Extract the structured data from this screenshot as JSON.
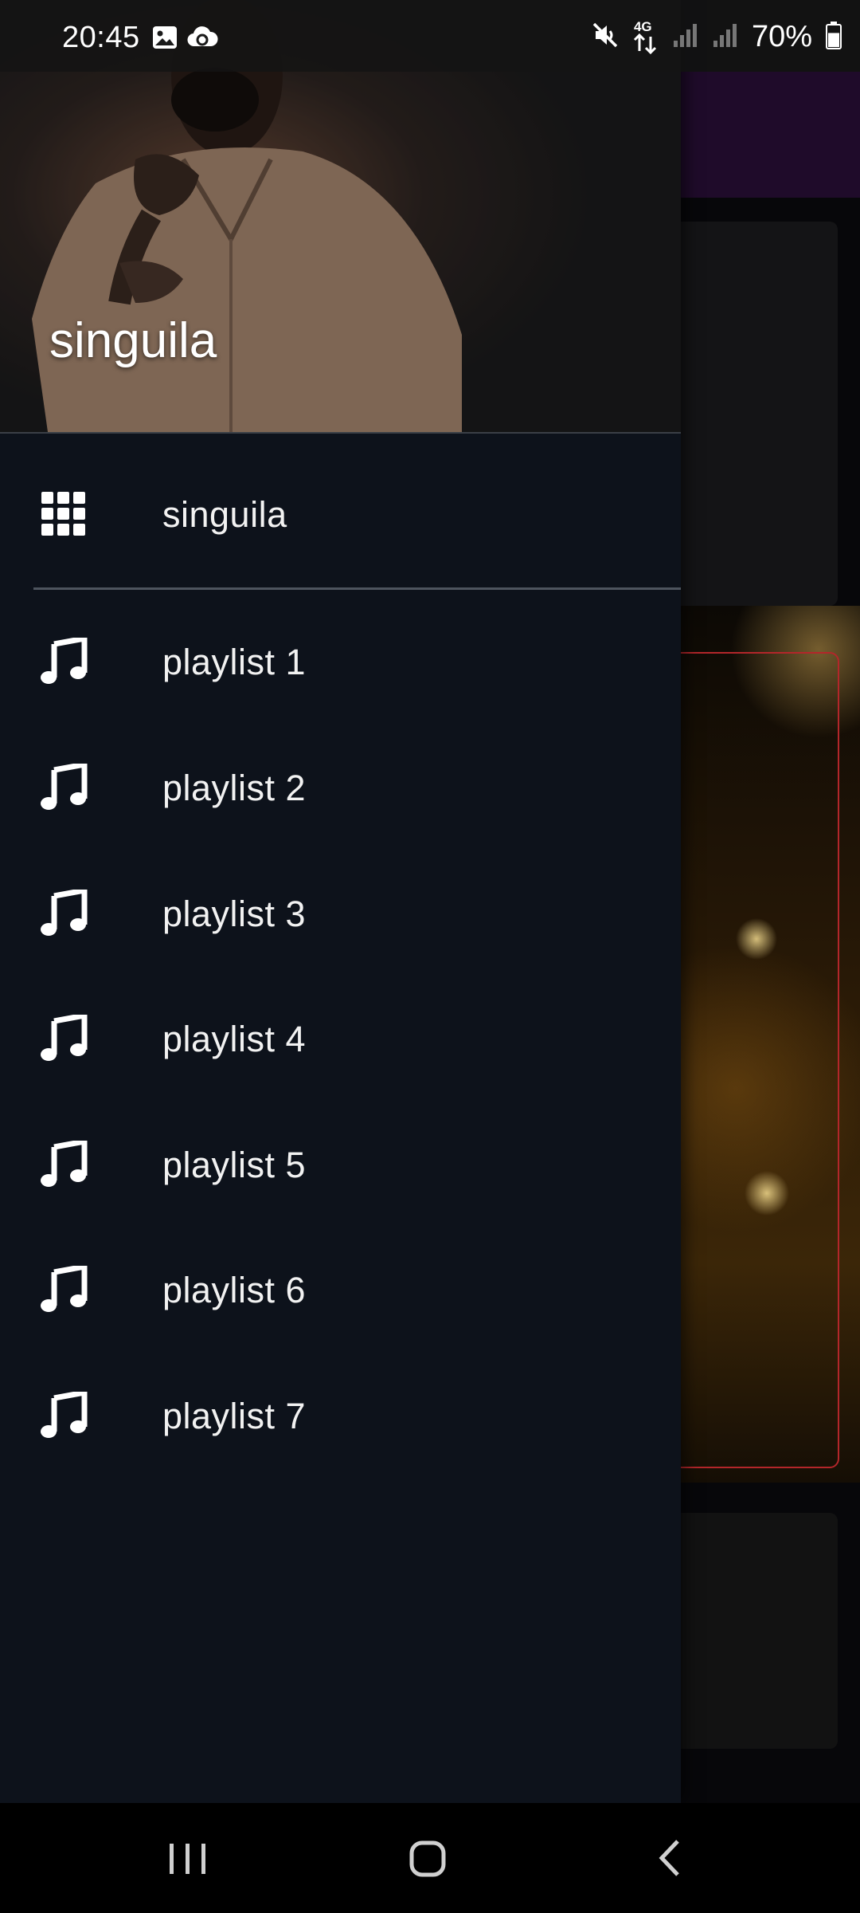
{
  "status_bar": {
    "time": "20:45",
    "notification_icons": [
      "image-icon",
      "cloud-sync-icon"
    ],
    "system_icons": [
      "mute-icon",
      "4g-data-icon",
      "signal-icon",
      "signal-icon"
    ],
    "network_label": "4G",
    "battery_percent": "70%",
    "battery_level": 0.7
  },
  "drawer": {
    "header_title": "singuila",
    "home_item": {
      "label": "singuila",
      "icon": "apps-grid-icon"
    },
    "playlists": [
      {
        "label": "playlist 1",
        "icon": "music-note-icon"
      },
      {
        "label": "playlist 2",
        "icon": "music-note-icon"
      },
      {
        "label": "playlist 3",
        "icon": "music-note-icon"
      },
      {
        "label": "playlist 4",
        "icon": "music-note-icon"
      },
      {
        "label": "playlist 5",
        "icon": "music-note-icon"
      },
      {
        "label": "playlist 6",
        "icon": "music-note-icon"
      },
      {
        "label": "playlist 7",
        "icon": "music-note-icon"
      }
    ]
  },
  "nav_bar": {
    "buttons": [
      "recent-apps-icon",
      "home-icon",
      "back-icon"
    ]
  },
  "colors": {
    "drawer_background": "#0d121b",
    "toolbar_accent": "#1f0b2a",
    "text": "#f2f2f2",
    "frame_accent": "#b3262a"
  }
}
